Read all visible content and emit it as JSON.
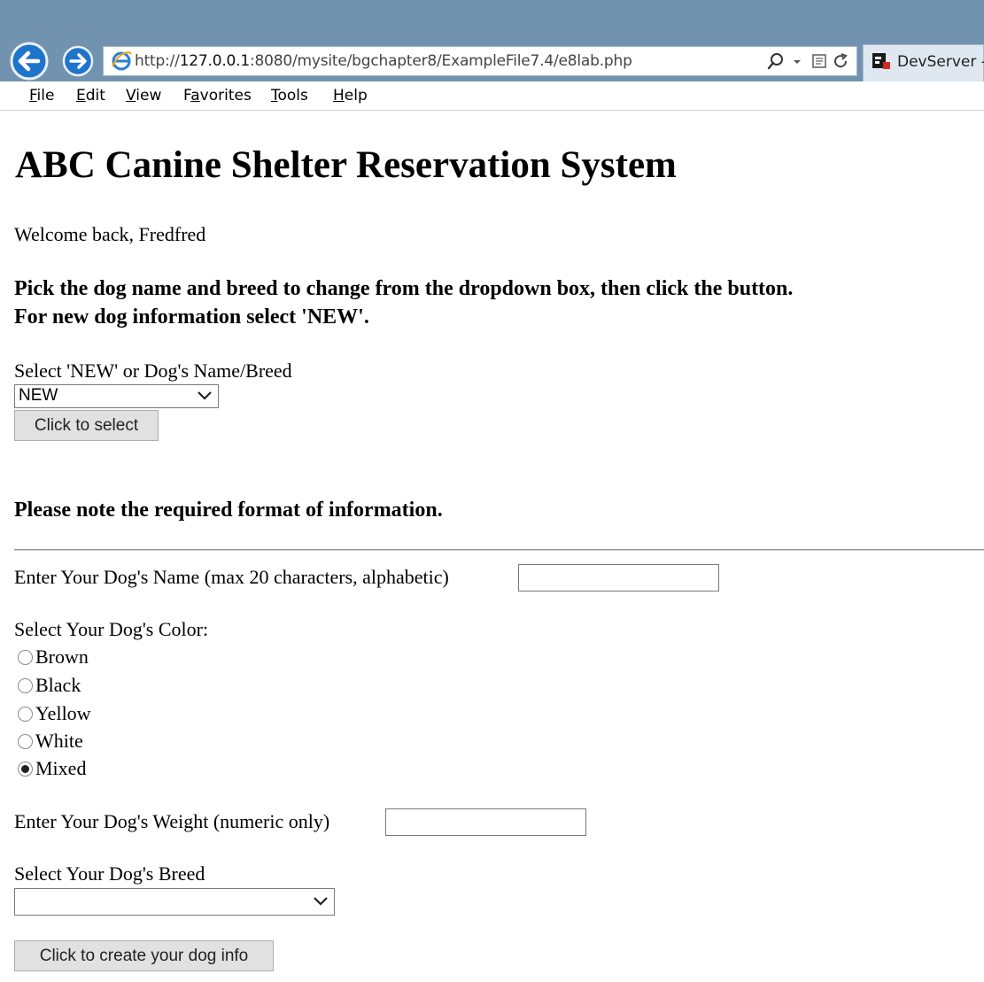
{
  "browser": {
    "url_prefix": "http://",
    "url_host": "127.0.0.1",
    "url_rest": ":8080/mysite/bgchapter8/ExampleFile7.4/e8lab.php",
    "tab_title": "DevServer -",
    "menu": [
      "File",
      "Edit",
      "View",
      "Favorites",
      "Tools",
      "Help"
    ],
    "menu_underline": [
      "F",
      "E",
      "V",
      "a",
      "T",
      "H"
    ]
  },
  "page": {
    "title": "ABC Canine Shelter Reservation System",
    "welcome": "Welcome back, Fredfred",
    "instruction_line1": "Pick the dog name and breed to change from the dropdown box, then click the button.",
    "instruction_line2": "For new dog information select 'NEW'.",
    "select_label": "Select 'NEW' or Dog's Name/Breed",
    "select_value": "NEW",
    "select_button": "Click to select",
    "format_note": "Please note the required format of information.",
    "name_label": "Enter Your Dog's Name (max 20 characters, alphabetic)",
    "name_value": "",
    "color_label": "Select Your Dog's Color:",
    "colors": [
      {
        "label": "Brown",
        "checked": false
      },
      {
        "label": "Black",
        "checked": false
      },
      {
        "label": "Yellow",
        "checked": false
      },
      {
        "label": "White",
        "checked": false
      },
      {
        "label": "Mixed",
        "checked": true
      }
    ],
    "weight_label": "Enter Your Dog's Weight (numeric only)",
    "weight_value": "",
    "breed_label": "Select Your Dog's Breed",
    "breed_value": "",
    "create_button": "Click to create your dog info"
  }
}
